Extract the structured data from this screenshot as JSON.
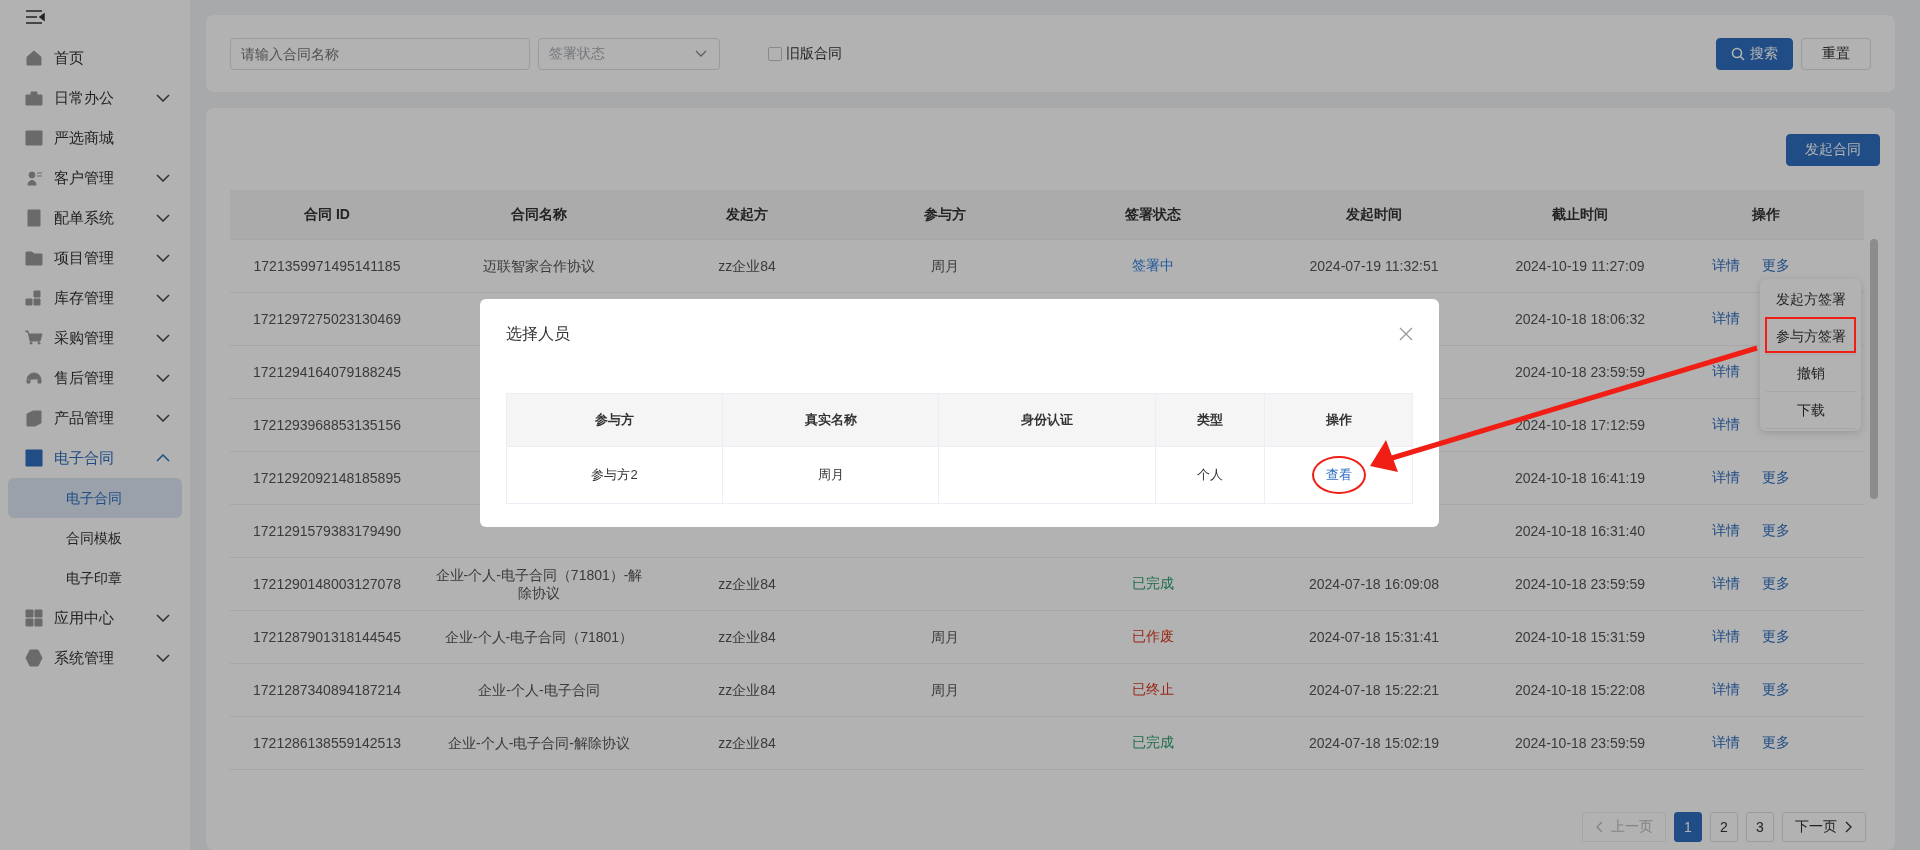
{
  "sidebar": {
    "items": [
      {
        "label": "首页",
        "kind": "link",
        "selected": false
      },
      {
        "label": "日常办公",
        "kind": "group",
        "expanded": false,
        "selected": false
      },
      {
        "label": "严选商城",
        "kind": "link",
        "selected": false
      },
      {
        "label": "客户管理",
        "kind": "group",
        "expanded": false,
        "selected": false
      },
      {
        "label": "配单系统",
        "kind": "group",
        "expanded": false,
        "selected": false
      },
      {
        "label": "项目管理",
        "kind": "group",
        "expanded": false,
        "selected": false
      },
      {
        "label": "库存管理",
        "kind": "group",
        "expanded": false,
        "selected": false
      },
      {
        "label": "采购管理",
        "kind": "group",
        "expanded": false,
        "selected": false
      },
      {
        "label": "售后管理",
        "kind": "group",
        "expanded": false,
        "selected": false
      },
      {
        "label": "产品管理",
        "kind": "group",
        "expanded": false,
        "selected": false
      },
      {
        "label": "电子合同",
        "kind": "group",
        "expanded": true,
        "selected": true,
        "children": [
          {
            "label": "电子合同",
            "selected": true
          },
          {
            "label": "合同模板",
            "selected": false
          },
          {
            "label": "电子印章",
            "selected": false
          }
        ]
      },
      {
        "label": "应用中心",
        "kind": "group",
        "expanded": false,
        "selected": false
      },
      {
        "label": "系统管理",
        "kind": "group",
        "expanded": false,
        "selected": false
      }
    ]
  },
  "filters": {
    "name": {
      "placeholder": "请输入合同名称"
    },
    "status": {
      "placeholder": "签署状态"
    },
    "old_version": {
      "label": "旧版合同",
      "checked": false
    },
    "search_button": "搜索",
    "reset_button": "重置"
  },
  "new_contract_button": "发起合同",
  "table": {
    "columns": [
      "合同 ID",
      "合同名称",
      "发起方",
      "参与方",
      "签署状态",
      "发起时间",
      "截止时间",
      "操作"
    ],
    "rows": [
      {
        "id": "1721359971495141185",
        "name": "迈联智家合作协议",
        "initiator": "zz企业84",
        "participant": "周月",
        "status": {
          "text": "签署中",
          "kind": "signing"
        },
        "start": "2024-07-19 11:32:51",
        "end": "2024-10-19 11:27:09",
        "actions": [
          "详情",
          "更多"
        ]
      },
      {
        "id": "1721297275023130469",
        "name": null,
        "initiator": null,
        "participant": null,
        "status": null,
        "start": null,
        "end": "2024-10-18 18:06:32",
        "actions": [
          "详情"
        ]
      },
      {
        "id": "1721294164079188245",
        "name": null,
        "initiator": null,
        "participant": null,
        "status": null,
        "start": null,
        "end": "2024-10-18 23:59:59",
        "actions": [
          "详情"
        ]
      },
      {
        "id": "1721293968853135156",
        "name": null,
        "initiator": null,
        "participant": null,
        "status": null,
        "start": null,
        "end": "2024-10-18 17:12:59",
        "actions": [
          "详情"
        ]
      },
      {
        "id": "1721292092148185895",
        "name": null,
        "initiator": null,
        "participant": null,
        "status": null,
        "start": null,
        "end": "2024-10-18 16:41:19",
        "actions": [
          "详情",
          "更多"
        ]
      },
      {
        "id": "1721291579383179490",
        "name": null,
        "initiator": null,
        "participant": null,
        "status": null,
        "start": null,
        "end": "2024-10-18 16:31:40",
        "actions": [
          "详情",
          "更多"
        ]
      },
      {
        "id": "1721290148003127078",
        "name": "企业-个人-电子合同（71801）-解除协议",
        "initiator": "zz企业84",
        "participant": null,
        "status": {
          "text": "已完成",
          "kind": "done"
        },
        "start": "2024-07-18 16:09:08",
        "end": "2024-10-18 23:59:59",
        "actions": [
          "详情",
          "更多"
        ]
      },
      {
        "id": "1721287901318144545",
        "name": "企业-个人-电子合同（71801）",
        "initiator": "zz企业84",
        "participant": "周月",
        "status": {
          "text": "已作废",
          "kind": "void"
        },
        "start": "2024-07-18 15:31:41",
        "end": "2024-10-18 15:31:59",
        "actions": [
          "详情",
          "更多"
        ]
      },
      {
        "id": "1721287340894187214",
        "name": "企业-个人-电子合同",
        "initiator": "zz企业84",
        "participant": "周月",
        "status": {
          "text": "已终止",
          "kind": "terminated"
        },
        "start": "2024-07-18 15:22:21",
        "end": "2024-10-18 15:22:08",
        "actions": [
          "详情",
          "更多"
        ]
      },
      {
        "id": "1721286138559142513",
        "name": "企业-个人-电子合同-解除协议",
        "initiator": "zz企业84",
        "participant": null,
        "status": {
          "text": "已完成",
          "kind": "done"
        },
        "start": "2024-07-18 15:02:19",
        "end": "2024-10-18 23:59:59",
        "actions": [
          "详情",
          "更多"
        ]
      }
    ]
  },
  "more_menu": {
    "items": [
      {
        "label": "发起方签署",
        "annotated": false
      },
      {
        "label": "参与方签署",
        "annotated": true
      },
      {
        "label": "撤销",
        "annotated": false
      },
      {
        "label": "下载",
        "annotated": false
      }
    ]
  },
  "pagination": {
    "prev": {
      "label": "上一页",
      "disabled": true
    },
    "pages": [
      {
        "label": "1",
        "selected": true
      },
      {
        "label": "2",
        "selected": false
      },
      {
        "label": "3",
        "selected": false
      }
    ],
    "next": {
      "label": "下一页",
      "disabled": false
    }
  },
  "dialog": {
    "title": "选择人员",
    "columns": [
      "参与方",
      "真实名称",
      "身份认证",
      "类型",
      "操作"
    ],
    "rows": [
      {
        "cells": [
          "参与方2",
          "周月",
          null,
          "个人"
        ],
        "action": {
          "label": "查看",
          "annotated": true
        }
      }
    ]
  }
}
